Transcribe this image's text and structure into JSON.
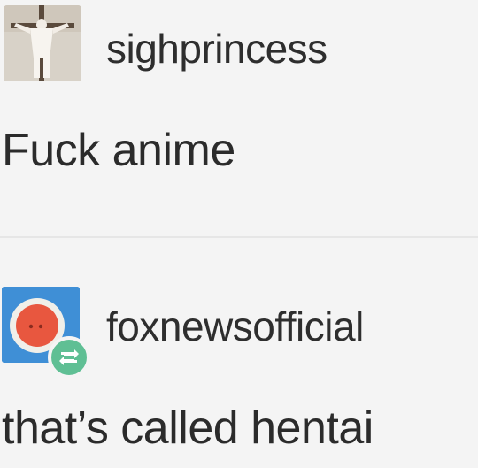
{
  "posts": [
    {
      "username": "sighprincess",
      "text": "Fuck anime",
      "avatar_icon": "crucifix-photo-avatar"
    },
    {
      "username": "foxnewsofficial",
      "text": "that’s called hentai",
      "avatar_icon": "red-circle-avatar",
      "badge_icon": "reblog-icon"
    }
  ],
  "colors": {
    "background": "#f4f4f4",
    "text": "#2b2b2b",
    "avatar_blue": "#3f8fd6",
    "avatar_red": "#e8573f",
    "reblog_green": "#5fbf94"
  }
}
